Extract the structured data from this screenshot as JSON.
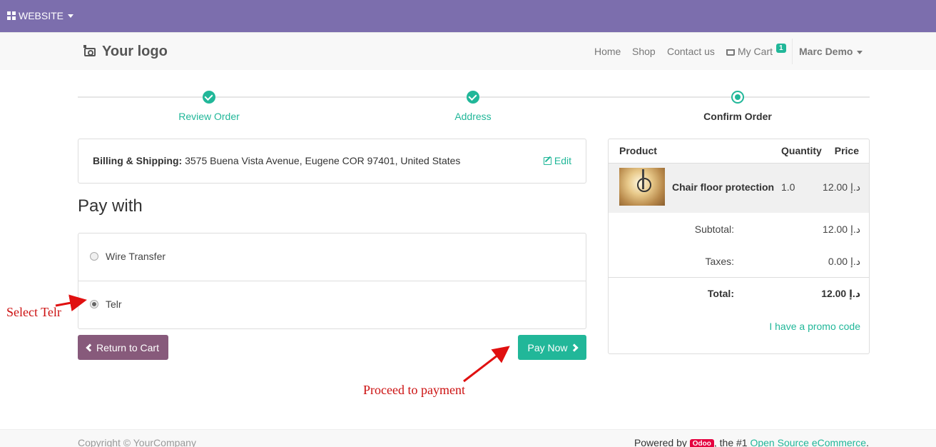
{
  "admin_bar": {
    "label": "WEBSITE"
  },
  "navbar": {
    "logo": "Your logo",
    "links": {
      "home": "Home",
      "shop": "Shop",
      "contact": "Contact us",
      "cart": "My Cart"
    },
    "cart_count": "1",
    "user": "Marc Demo"
  },
  "wizard": {
    "steps": [
      {
        "label": "Review Order",
        "state": "done"
      },
      {
        "label": "Address",
        "state": "done"
      },
      {
        "label": "Confirm Order",
        "state": "current"
      }
    ]
  },
  "billing": {
    "label": "Billing & Shipping:",
    "address": "3575 Buena Vista Avenue, Eugene COR 97401, United States",
    "edit": "Edit"
  },
  "payment": {
    "title": "Pay with",
    "methods": [
      {
        "label": "Wire Transfer",
        "selected": false
      },
      {
        "label": "Telr",
        "selected": true
      }
    ]
  },
  "buttons": {
    "return": "Return to Cart",
    "pay": "Pay Now"
  },
  "summary": {
    "headers": {
      "product": "Product",
      "quantity": "Quantity",
      "price": "Price"
    },
    "product": {
      "name": "Chair floor protection",
      "qty": "1.0",
      "price": "12.00 د.إ"
    },
    "subtotal_label": "Subtotal:",
    "subtotal": "12.00 د.إ",
    "taxes_label": "Taxes:",
    "taxes": "0.00 د.إ",
    "total_label": "Total:",
    "total": "12.00 د.إ",
    "promo": "I have a promo code"
  },
  "annotations": {
    "select": "Select Telr",
    "proceed": "Proceed to payment"
  },
  "footer": {
    "copyright": "Copyright © YourCompany",
    "powered_prefix": "Powered by",
    "odoo": "Odoo",
    "powered_middle": ", the #1",
    "link": "Open Source eCommerce",
    "powered_suffix": "."
  },
  "colors": {
    "admin_bar": "#7c6ead",
    "primary": "#21b799",
    "secondary": "#875a7b",
    "annotation": "#cc1111"
  }
}
